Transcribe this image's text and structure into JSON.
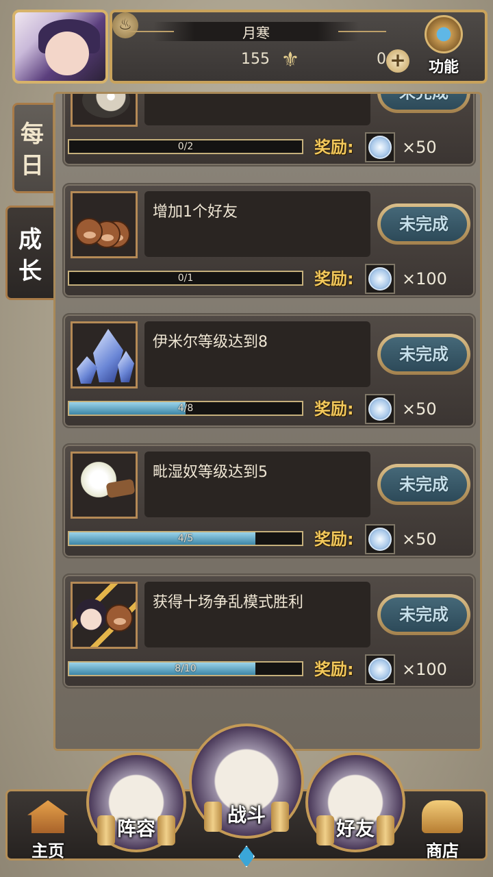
{
  "header": {
    "player_name": "月寒",
    "currency1_value": "155",
    "currency2_value": "0",
    "function_label": "功能",
    "icons": [
      "flame-currency-icon",
      "butterfly-icon",
      "plus-icon",
      "gear-icon"
    ]
  },
  "tabs": [
    {
      "label": "每日",
      "active": false
    },
    {
      "label": "成长",
      "active": true
    }
  ],
  "tasks": [
    {
      "description": "",
      "status": "未完成",
      "progress_text": "0/2",
      "progress": 0.0,
      "reward_label": "奖励:",
      "reward_qty": "×50",
      "icon": "egg-icon"
    },
    {
      "description": "增加1个好友",
      "status": "未完成",
      "progress_text": "0/1",
      "progress": 0.0,
      "reward_label": "奖励:",
      "reward_qty": "×100",
      "icon": "bears-icon"
    },
    {
      "description": "伊米尔等级达到8",
      "status": "未完成",
      "progress_text": "4/8",
      "progress": 0.5,
      "reward_label": "奖励:",
      "reward_qty": "×50",
      "icon": "crystal-icon"
    },
    {
      "description": "毗湿奴等级达到5",
      "status": "未完成",
      "progress_text": "4/5",
      "progress": 0.8,
      "reward_label": "奖励:",
      "reward_qty": "×50",
      "icon": "flower-icon"
    },
    {
      "description": "获得十场争乱模式胜利",
      "status": "未完成",
      "progress_text": "8/10",
      "progress": 0.8,
      "reward_label": "奖励:",
      "reward_qty": "×100",
      "icon": "battle-icon"
    }
  ],
  "nav": {
    "home": "主页",
    "lineup": "阵容",
    "battle": "战斗",
    "friends": "好友",
    "shop": "商店"
  },
  "colors": {
    "reward_label": "#f2c85b",
    "progress_fill": "#5aa9cc",
    "frame_gold": "#c9a35c"
  }
}
